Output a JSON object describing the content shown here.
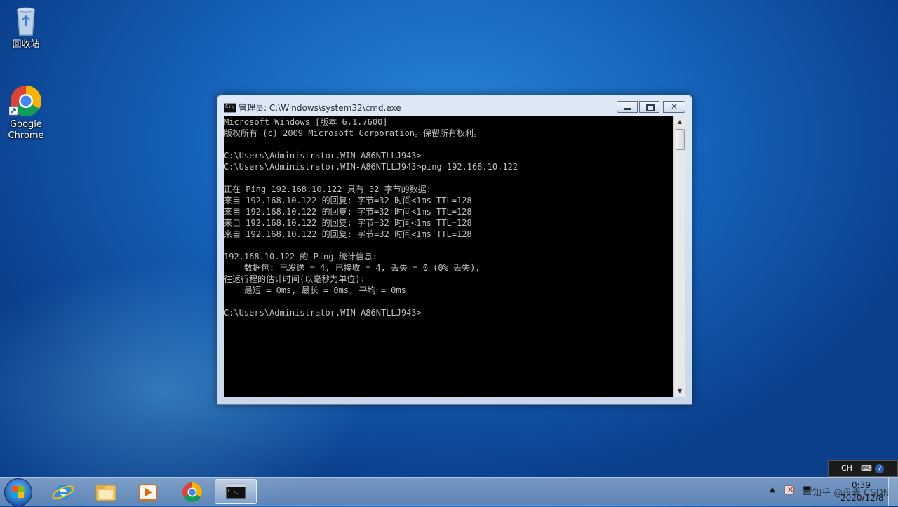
{
  "desktop": {
    "icons": [
      {
        "label": "回收站",
        "icon": "recycle-bin-icon"
      },
      {
        "label": "Google\nChrome",
        "icon": "chrome-icon"
      }
    ]
  },
  "window": {
    "title": "管理员: C:\\Windows\\system32\\cmd.exe",
    "console_text": "Microsoft Windows [版本 6.1.7600]\n版权所有 (c) 2009 Microsoft Corporation。保留所有权利。\n\nC:\\Users\\Administrator.WIN-A86NTLLJ943>\nC:\\Users\\Administrator.WIN-A86NTLLJ943>ping 192.168.10.122\n\n正在 Ping 192.168.10.122 具有 32 字节的数据:\n来自 192.168.10.122 的回复: 字节=32 时间<1ms TTL=128\n来自 192.168.10.122 的回复: 字节=32 时间<1ms TTL=128\n来自 192.168.10.122 的回复: 字节=32 时间<1ms TTL=128\n来自 192.168.10.122 的回复: 字节=32 时间<1ms TTL=128\n\n192.168.10.122 的 Ping 统计信息:\n    数据包: 已发送 = 4, 已接收 = 4, 丢失 = 0 (0% 丢失),\n往返行程的估计时间(以毫秒为单位):\n    最短 = 0ms, 最长 = 0ms, 平均 = 0ms\n\nC:\\Users\\Administrator.WIN-A86NTLLJ943>"
  },
  "taskbar": {
    "pinned": [
      "ie-icon",
      "explorer-folder-icon",
      "media-player-icon",
      "chrome-icon",
      "cmd-icon"
    ],
    "tray": {
      "lang": "CH",
      "time": "0:39",
      "date": "2020/12/8",
      "watermark": "知乎 @丹青 CSDN"
    }
  },
  "colors": {
    "console_bg": "#000000",
    "console_fg": "#c0c0c0"
  }
}
